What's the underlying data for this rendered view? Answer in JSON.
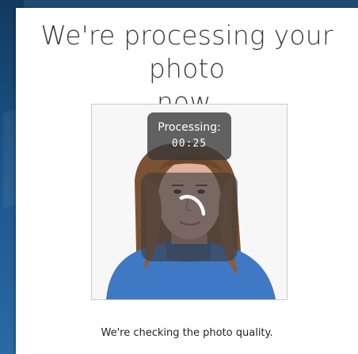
{
  "page": {
    "title": "We're processing your photo\nnow.",
    "caption": "We're checking the photo quality."
  },
  "processing": {
    "label": "Processing:",
    "timer": "00:25"
  },
  "icons": {
    "spinner": "loading-spinner-icon"
  },
  "colors": {
    "background": "#1e4a72",
    "card": "#ffffff",
    "title_text": "#3b3b3b",
    "overlay": "#373737",
    "sweater": "#3f78c4"
  }
}
